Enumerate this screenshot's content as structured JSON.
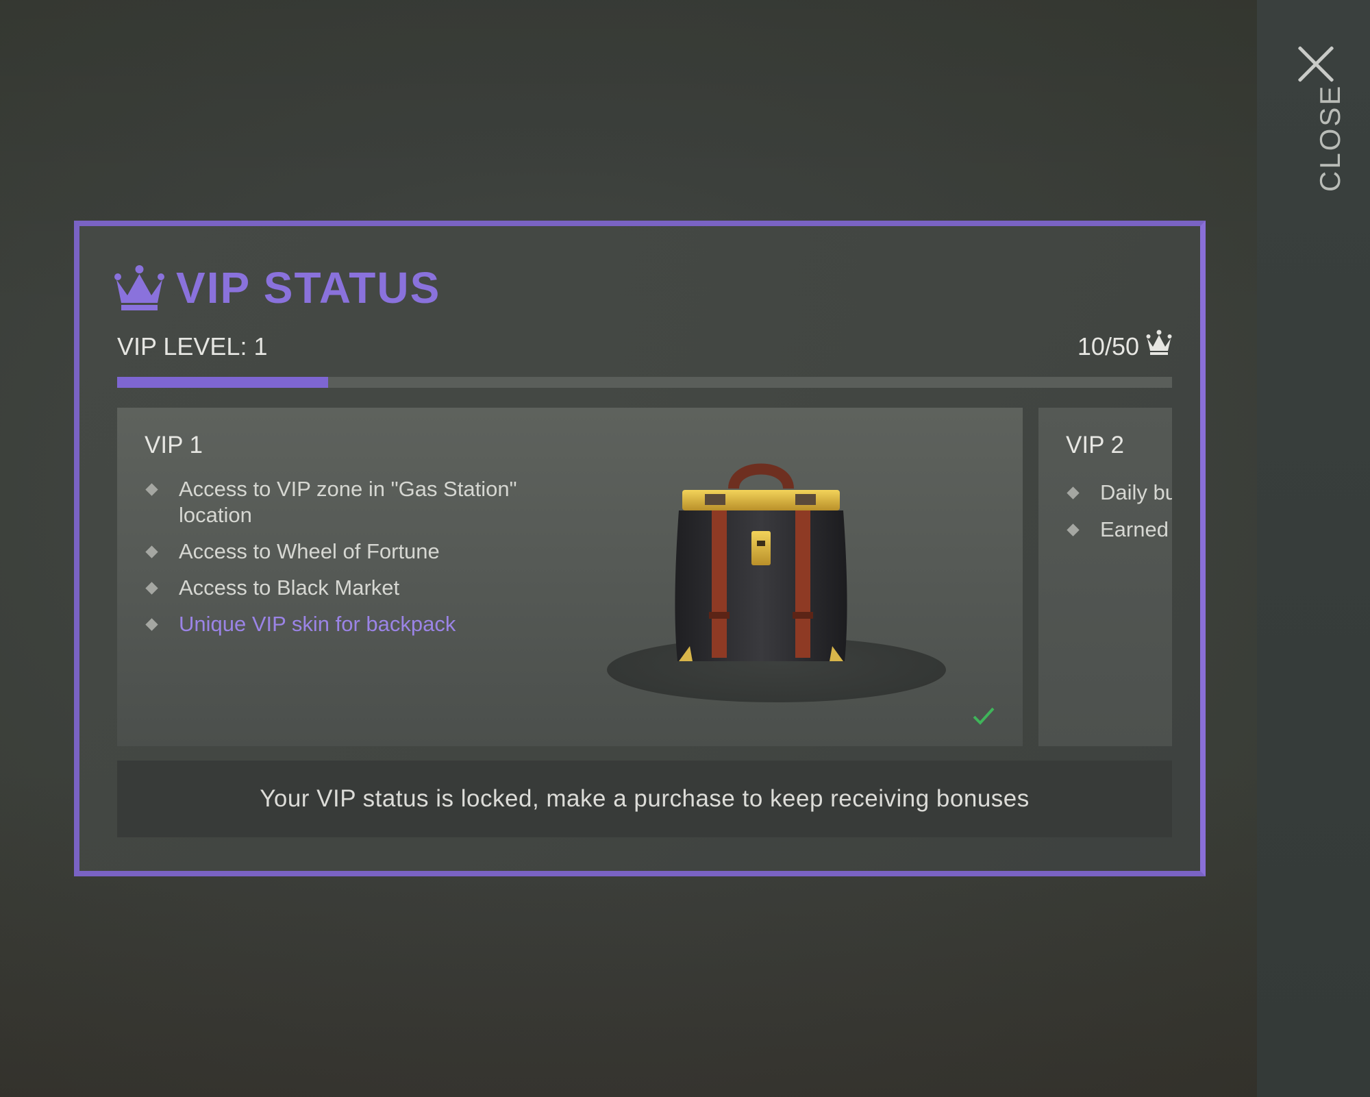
{
  "close": {
    "label": "CLOSE",
    "icon": "close-icon"
  },
  "vip": {
    "title": "VIP STATUS",
    "level_label": "VIP LEVEL: 1",
    "progress_text": "10/50",
    "progress_current": 10,
    "progress_max": 50,
    "accent_color": "#8a72dc"
  },
  "cards": [
    {
      "title": "VIP 1",
      "benefits": [
        "Access to VIP zone in \"Gas Station\" location",
        "Access to Wheel of Fortune",
        "Access to Black Market",
        "Unique VIP skin for backpack"
      ],
      "reward_image": "vip-backpack",
      "status": "unlocked-check"
    },
    {
      "title": "VIP 2",
      "benefits": [
        "Daily bu",
        "Earned e"
      ]
    }
  ],
  "notice": "Your VIP status is locked, make a purchase to keep receiving bonuses"
}
